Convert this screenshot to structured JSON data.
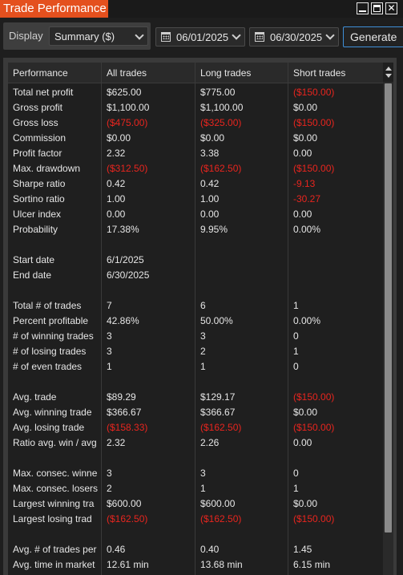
{
  "window": {
    "title": "Trade Performance"
  },
  "toolbar": {
    "display_label": "Display",
    "display_value": "Summary ($)",
    "start_date": "06/01/2025",
    "end_date": "06/30/2025",
    "generate_label": "Generate"
  },
  "grid": {
    "headers": [
      "Performance",
      "All trades",
      "Long trades",
      "Short trades"
    ],
    "rows": [
      {
        "label": "Total net profit",
        "all": "$625.00",
        "long": "$775.00",
        "short": "($150.00)"
      },
      {
        "label": "Gross profit",
        "all": "$1,100.00",
        "long": "$1,100.00",
        "short": "$0.00"
      },
      {
        "label": "Gross loss",
        "all": "($475.00)",
        "long": "($325.00)",
        "short": "($150.00)"
      },
      {
        "label": "Commission",
        "all": "$0.00",
        "long": "$0.00",
        "short": "$0.00"
      },
      {
        "label": "Profit factor",
        "all": "2.32",
        "long": "3.38",
        "short": "0.00"
      },
      {
        "label": "Max. drawdown",
        "all": "($312.50)",
        "long": "($162.50)",
        "short": "($150.00)"
      },
      {
        "label": "Sharpe ratio",
        "all": "0.42",
        "long": "0.42",
        "short": "-9.13"
      },
      {
        "label": "Sortino ratio",
        "all": "1.00",
        "long": "1.00",
        "short": "-30.27"
      },
      {
        "label": "Ulcer index",
        "all": "0.00",
        "long": "0.00",
        "short": "0.00"
      },
      {
        "label": "Probability",
        "all": "17.38%",
        "long": "9.95%",
        "short": "0.00%"
      },
      {
        "label": "",
        "all": "",
        "long": "",
        "short": ""
      },
      {
        "label": "Start date",
        "all": "6/1/2025",
        "long": "",
        "short": ""
      },
      {
        "label": "End date",
        "all": "6/30/2025",
        "long": "",
        "short": ""
      },
      {
        "label": "",
        "all": "",
        "long": "",
        "short": ""
      },
      {
        "label": "Total # of trades",
        "all": "7",
        "long": "6",
        "short": "1"
      },
      {
        "label": "Percent profitable",
        "all": "42.86%",
        "long": "50.00%",
        "short": "0.00%"
      },
      {
        "label": "# of winning trades",
        "all": "3",
        "long": "3",
        "short": "0"
      },
      {
        "label": "# of losing trades",
        "all": "3",
        "long": "2",
        "short": "1"
      },
      {
        "label": "# of even trades",
        "all": "1",
        "long": "1",
        "short": "0"
      },
      {
        "label": "",
        "all": "",
        "long": "",
        "short": ""
      },
      {
        "label": "Avg. trade",
        "all": "$89.29",
        "long": "$129.17",
        "short": "($150.00)"
      },
      {
        "label": "Avg. winning trade",
        "all": "$366.67",
        "long": "$366.67",
        "short": "$0.00"
      },
      {
        "label": "Avg. losing trade",
        "all": "($158.33)",
        "long": "($162.50)",
        "short": "($150.00)"
      },
      {
        "label": "Ratio avg. win / avg",
        "all": "2.32",
        "long": "2.26",
        "short": "0.00"
      },
      {
        "label": "",
        "all": "",
        "long": "",
        "short": ""
      },
      {
        "label": "Max. consec. winne",
        "all": "3",
        "long": "3",
        "short": "0"
      },
      {
        "label": "Max. consec. losers",
        "all": "2",
        "long": "1",
        "short": "1"
      },
      {
        "label": "Largest winning tra",
        "all": "$600.00",
        "long": "$600.00",
        "short": "$0.00"
      },
      {
        "label": "Largest losing trad",
        "all": "($162.50)",
        "long": "($162.50)",
        "short": "($150.00)"
      },
      {
        "label": "",
        "all": "",
        "long": "",
        "short": ""
      },
      {
        "label": "Avg. # of trades per",
        "all": "0.46",
        "long": "0.40",
        "short": "1.45"
      },
      {
        "label": "Avg. time in market",
        "all": "12.61 min",
        "long": "13.68 min",
        "short": "6.15 min"
      }
    ]
  },
  "colors": {
    "accent": "#e4501e",
    "negative": "#e8251f",
    "focus": "#3f8fd8"
  }
}
